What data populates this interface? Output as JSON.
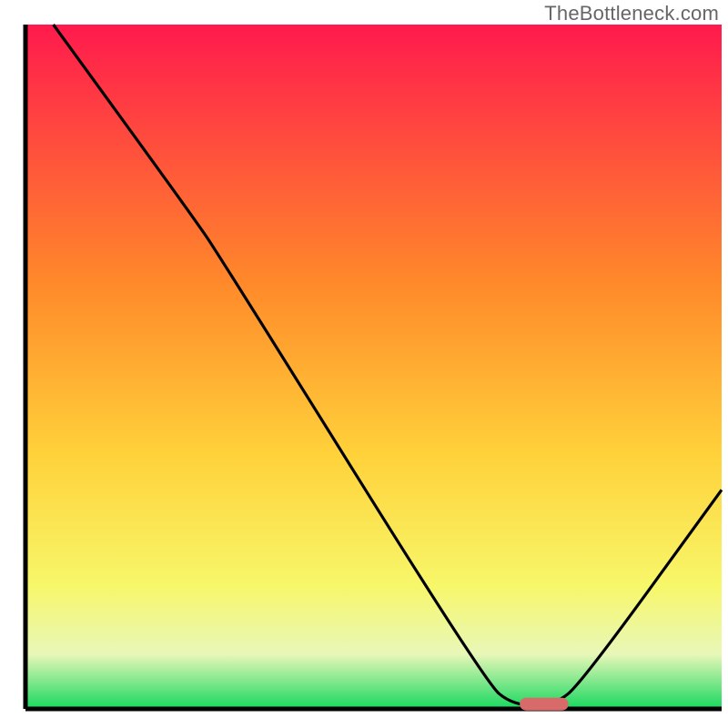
{
  "watermark": "TheBottleneck.com",
  "colors": {
    "axis": "#000000",
    "curve": "#000000",
    "marker_fill": "#d96a6a",
    "grad_top": "#ff1a4d",
    "grad_upper_mid": "#ff8a2a",
    "grad_mid": "#ffd23a",
    "grad_lower_mid": "#f7f76a",
    "grad_low_band": "#e8f7b8",
    "grad_bottom": "#18d860"
  },
  "chart_data": {
    "type": "line",
    "title": "",
    "xlabel": "",
    "ylabel": "",
    "xlim": [
      0,
      100
    ],
    "ylim": [
      0,
      100
    ],
    "background_gradient": [
      {
        "offset": 0.0,
        "color": "#ff1a4d"
      },
      {
        "offset": 0.38,
        "color": "#ff8a2a"
      },
      {
        "offset": 0.63,
        "color": "#ffd23a"
      },
      {
        "offset": 0.82,
        "color": "#f7f76a"
      },
      {
        "offset": 0.92,
        "color": "#e8f7b8"
      },
      {
        "offset": 1.0,
        "color": "#18d860"
      }
    ],
    "curve_points": [
      {
        "x": 4.0,
        "y": 100.0
      },
      {
        "x": 24.0,
        "y": 72.0
      },
      {
        "x": 28.0,
        "y": 66.0
      },
      {
        "x": 66.0,
        "y": 4.0
      },
      {
        "x": 70.0,
        "y": 0.5
      },
      {
        "x": 76.0,
        "y": 0.5
      },
      {
        "x": 80.0,
        "y": 4.0
      },
      {
        "x": 100.0,
        "y": 32.0
      }
    ],
    "marker": {
      "x_start": 71.0,
      "x_end": 78.0,
      "y": 0.7
    }
  }
}
